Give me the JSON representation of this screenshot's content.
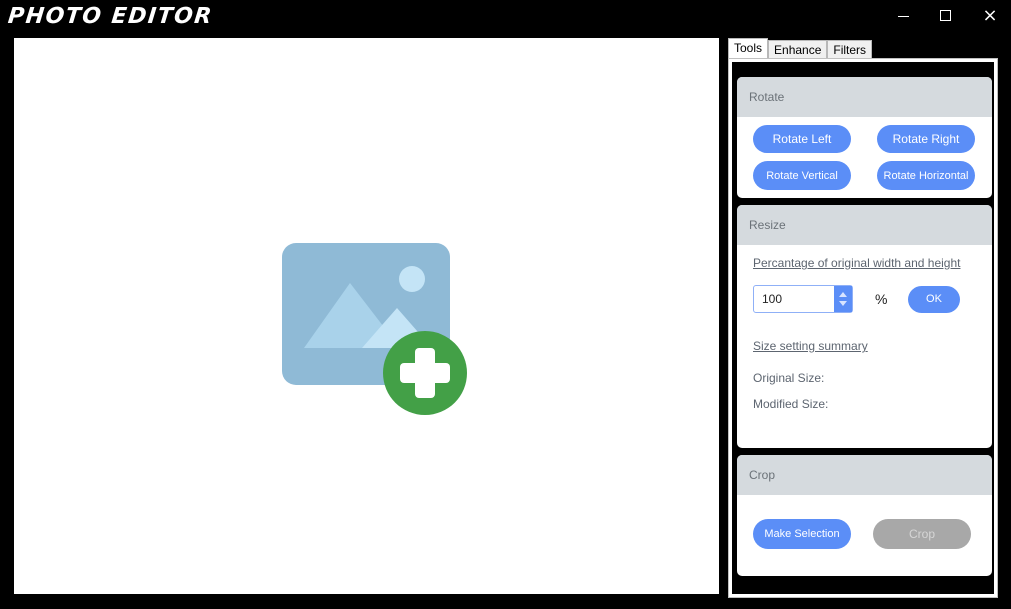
{
  "app": {
    "title": "PHOTO EDITOR"
  },
  "window_controls": {
    "minimize": "minimize",
    "maximize": "maximize",
    "close": "×"
  },
  "tabs": [
    {
      "label": "Tools",
      "active": true
    },
    {
      "label": "Enhance",
      "active": false
    },
    {
      "label": "Filters",
      "active": false
    }
  ],
  "rotate": {
    "header": "Rotate",
    "rotate_left": "Rotate Left",
    "rotate_right": "Rotate Right",
    "rotate_vertical": "Rotate Vertical",
    "rotate_horizontal": "Rotate Horizontal"
  },
  "resize": {
    "header": "Resize",
    "percentage_link": "Percantage of original width and height",
    "percent_value": "100",
    "percent_symbol": "%",
    "ok_label": "OK",
    "summary_link": "Size setting summary",
    "original_size_label": "Original Size:",
    "modified_size_label": "Modified Size:"
  },
  "crop": {
    "header": "Crop",
    "make_selection": "Make Selection",
    "crop_label": "Crop"
  },
  "colors": {
    "accent": "#5b8ef7",
    "disabled": "#a8a8a8",
    "header_bg": "#d5dade",
    "add_badge": "#43a047",
    "placeholder_image": "#8fbad6"
  },
  "icons": {
    "placeholder": "add-image-icon"
  }
}
